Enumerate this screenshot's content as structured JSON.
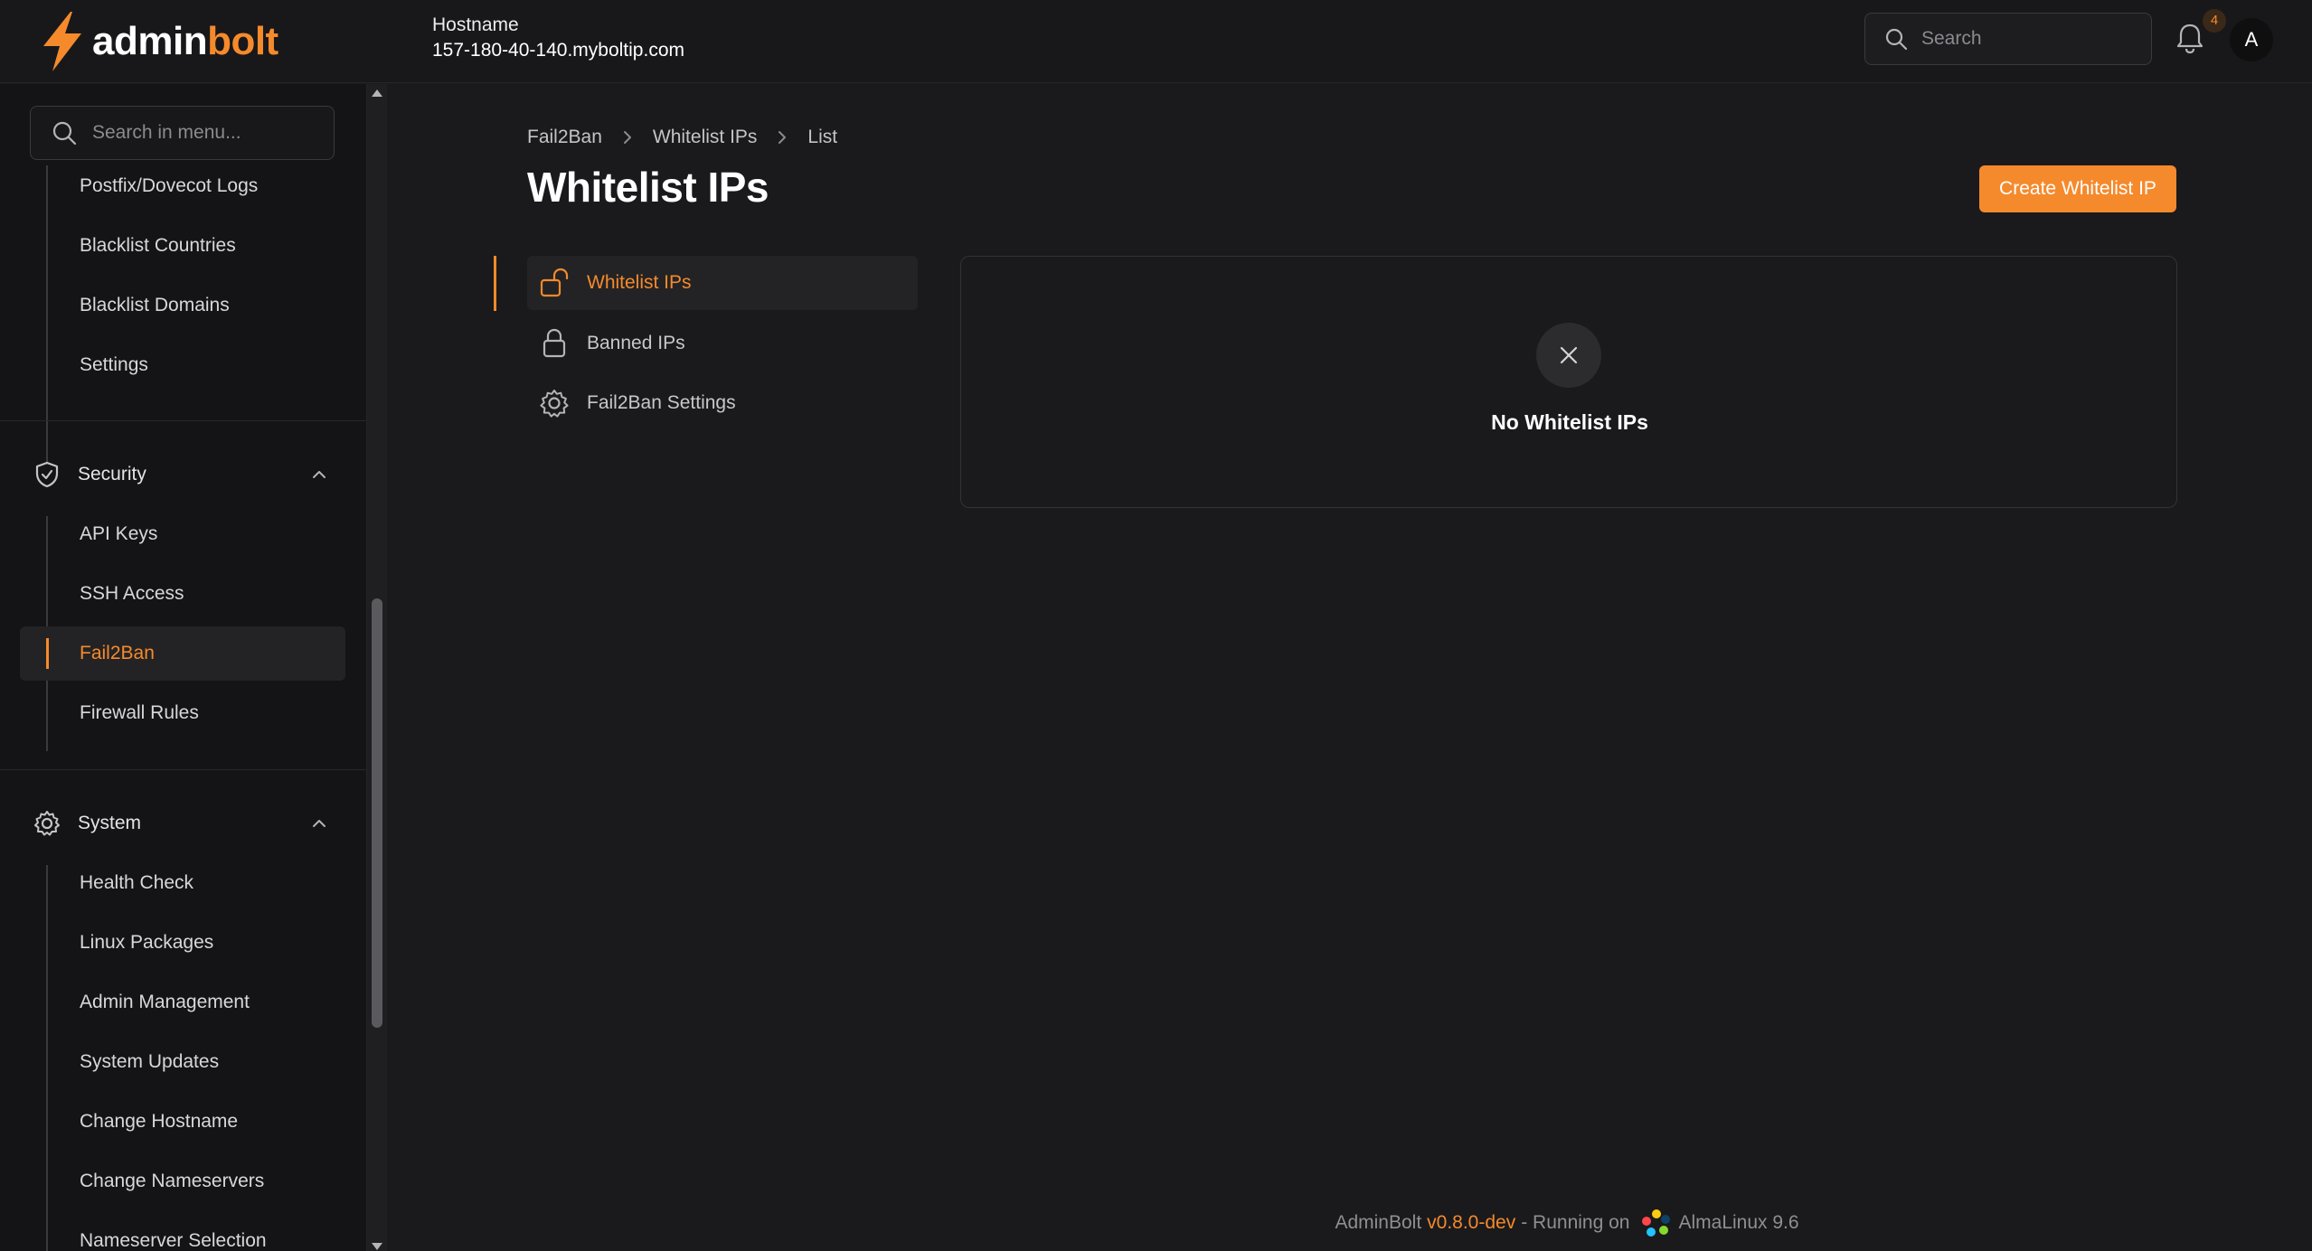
{
  "brand": {
    "name_part1": "admin",
    "name_part2": "bolt",
    "accent": "#f58a2c"
  },
  "header": {
    "hostname_label": "Hostname",
    "hostname_value": "157-180-40-140.myboltip.com",
    "search_placeholder": "Search",
    "notification_count": "4",
    "avatar_initial": "A"
  },
  "sidebar": {
    "search_placeholder": "Search in menu...",
    "top_items": [
      {
        "label": "Postfix/Dovecot Logs"
      },
      {
        "label": "Blacklist Countries"
      },
      {
        "label": "Blacklist Domains"
      },
      {
        "label": "Settings"
      }
    ],
    "security": {
      "label": "Security",
      "icon": "shield-check-icon",
      "items": [
        {
          "label": "API Keys"
        },
        {
          "label": "SSH Access"
        },
        {
          "label": "Fail2Ban",
          "active": true
        },
        {
          "label": "Firewall Rules"
        }
      ]
    },
    "system": {
      "label": "System",
      "icon": "gear-icon",
      "items": [
        {
          "label": "Health Check"
        },
        {
          "label": "Linux Packages"
        },
        {
          "label": "Admin Management"
        },
        {
          "label": "System Updates"
        },
        {
          "label": "Change Hostname"
        },
        {
          "label": "Change Nameservers"
        },
        {
          "label": "Nameserver Selection"
        }
      ]
    }
  },
  "breadcrumb": [
    "Fail2Ban",
    "Whitelist IPs",
    "List"
  ],
  "page": {
    "title": "Whitelist IPs",
    "create_button": "Create Whitelist IP"
  },
  "subnav": [
    {
      "label": "Whitelist IPs",
      "icon": "unlock-icon",
      "active": true
    },
    {
      "label": "Banned IPs",
      "icon": "lock-icon"
    },
    {
      "label": "Fail2Ban Settings",
      "icon": "gear-icon"
    }
  ],
  "empty_state": {
    "message": "No Whitelist IPs",
    "icon": "close-icon"
  },
  "footer": {
    "app": "AdminBolt",
    "version": "v0.8.0-dev",
    "running_on": "- Running on",
    "os": "AlmaLinux 9.6"
  }
}
